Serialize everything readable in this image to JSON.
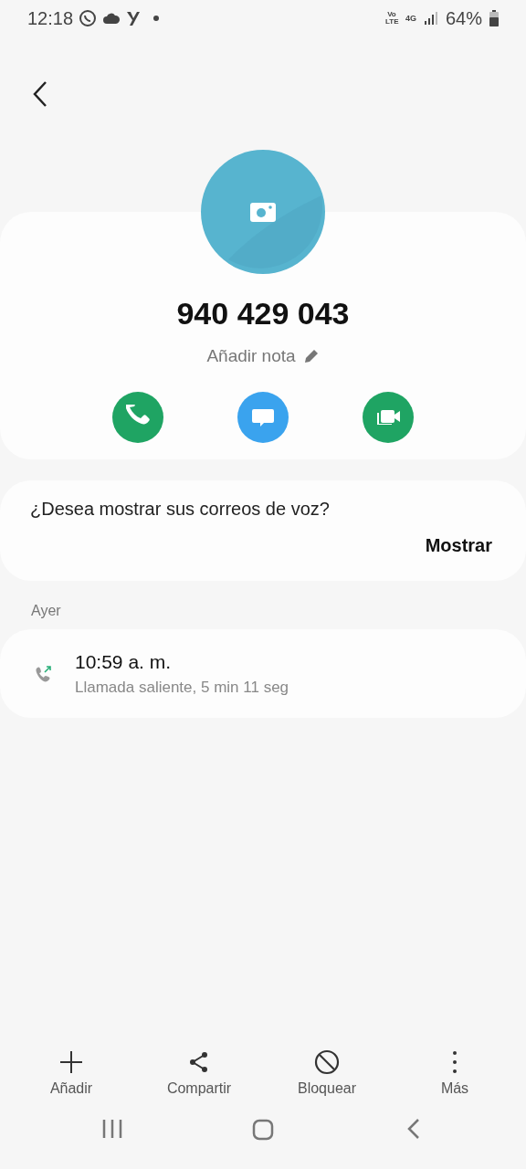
{
  "status_bar": {
    "time": "12:18",
    "volte": "Vo LTE",
    "network": "4G",
    "battery": "64%"
  },
  "contact": {
    "number": "940 429 043",
    "note_link": "Añadir nota",
    "actions": [
      {
        "kind": "call",
        "color": "#1fa463"
      },
      {
        "kind": "message",
        "color": "#3aa3ee"
      },
      {
        "kind": "video",
        "color": "#1fa463"
      }
    ]
  },
  "voicemail": {
    "question": "¿Desea mostrar sus correos de voz?",
    "button": "Mostrar"
  },
  "history": {
    "group": "Ayer",
    "calls": [
      {
        "time": "10:59 a. m.",
        "detail": "Llamada saliente, 5 min 11 seg",
        "kind": "outgoing"
      }
    ]
  },
  "bottom_actions": [
    {
      "label": "Añadir",
      "kind": "add"
    },
    {
      "label": "Compartir",
      "kind": "share"
    },
    {
      "label": "Bloquear",
      "kind": "block"
    },
    {
      "label": "Más",
      "kind": "more"
    }
  ]
}
